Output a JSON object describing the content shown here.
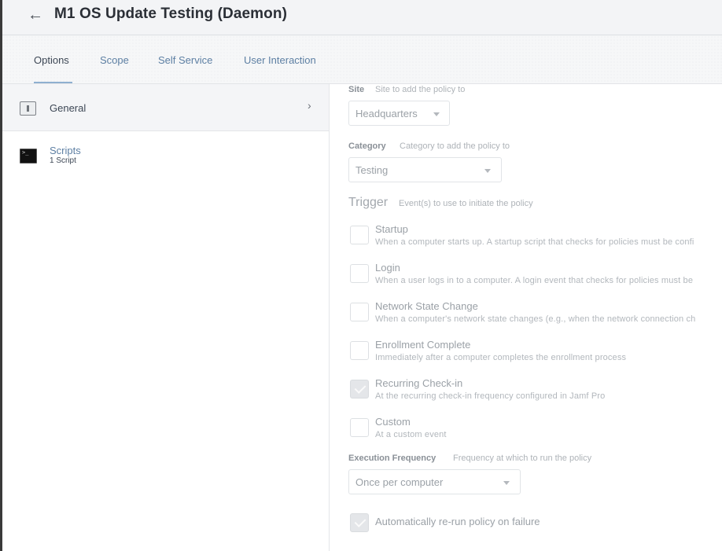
{
  "header": {
    "back_icon": "left-arrow-icon",
    "title": "M1 OS Update Testing (Daemon)"
  },
  "tabs": [
    {
      "label": "Options",
      "active": true
    },
    {
      "label": "Scope",
      "active": false
    },
    {
      "label": "Self Service",
      "active": false
    },
    {
      "label": "User Interaction",
      "active": false
    }
  ],
  "sidebar": {
    "items": [
      {
        "label": "General",
        "sublabel": "",
        "icon": "general-switch-icon",
        "selected": true
      },
      {
        "label": "Scripts",
        "sublabel": "1 Script",
        "icon": "terminal-icon",
        "selected": false
      }
    ]
  },
  "form": {
    "site": {
      "label": "Site",
      "desc": "Site to add the policy to",
      "value": "Headquarters"
    },
    "category": {
      "label": "Category",
      "desc": "Category to add the policy to",
      "value": "Testing"
    },
    "trigger": {
      "heading": "Trigger",
      "desc": "Event(s) to use to initiate the policy",
      "options": [
        {
          "title": "Startup",
          "desc": "When a computer starts up. A startup script that checks for policies must be confi",
          "checked": false
        },
        {
          "title": "Login",
          "desc": "When a user logs in to a computer. A login event that checks for policies must be",
          "checked": false
        },
        {
          "title": "Network State Change",
          "desc": "When a computer's network state changes (e.g., when the network connection ch",
          "checked": false
        },
        {
          "title": "Enrollment Complete",
          "desc": "Immediately after a computer completes the enrollment process",
          "checked": false
        },
        {
          "title": "Recurring Check-in",
          "desc": "At the recurring check-in frequency configured in Jamf Pro",
          "checked": true
        },
        {
          "title": "Custom",
          "desc": "At a custom event",
          "checked": false
        }
      ]
    },
    "execution_frequency": {
      "label": "Execution Frequency",
      "desc": "Frequency at which to run the policy",
      "value": "Once per computer"
    },
    "rerun": {
      "label": "Automatically re-run policy on failure",
      "checked": true
    }
  },
  "colors": {
    "link": "#5d7fa3",
    "tab_underline": "#8fb0d0",
    "header_bg": "#f3f4f6"
  }
}
